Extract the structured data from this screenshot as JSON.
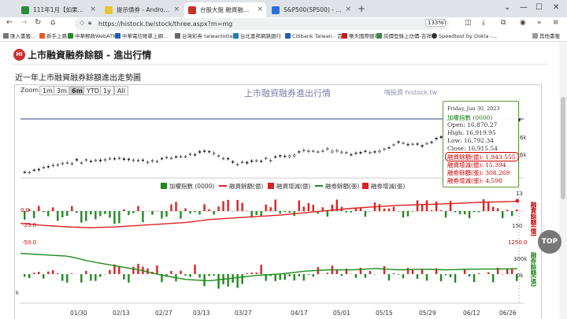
{
  "browser": {
    "tabs": [
      {
        "label": "111年1月【如果認為會影響"
      },
      {
        "label": "提示債券 - Android台灣中文"
      },
      {
        "label": "台股大盤 融資融券進出行情 -"
      },
      {
        "label": "S&P500(SP500) - 動態日K線圖"
      }
    ],
    "url": "https://histock.tw/stock/three.aspx?m=mg",
    "zoom": "133%",
    "bookmarks": [
      "匯入書籤...",
      "新手上路",
      "中華郵政WebATM",
      "中華電信帳單上網...",
      "台灣彩券 taiwanlottery",
      "台北富邦網路銀行",
      "Citibank Taiwan - 首頁",
      "樂天國際銀行",
      "房價登錄上坊價-吉祥",
      "Speedtest by Ookla -..."
    ],
    "other_bookmarks": "其他書籤"
  },
  "page": {
    "logo": "Hi",
    "title": "上市融資融券餘額 - 進出行情",
    "subtitle": "近一年上市融資融券餘額進出走勢圖",
    "top_button": "TOP"
  },
  "chart_toolbar": {
    "zoom_label": "Zoom",
    "buttons": [
      "1m",
      "3m",
      "6m",
      "YTD",
      "1y",
      "All"
    ],
    "selected": "6m"
  },
  "chart_data": {
    "type": "line",
    "title": "上市融資融券進出行情",
    "credit": "嗨投資 histock.tw",
    "legend": [
      {
        "name": "加權指數 (0000)",
        "color": "#1e8a1e",
        "kind": "box"
      },
      {
        "name": "融資餘額(億)",
        "color": "#e02020",
        "kind": "line"
      },
      {
        "name": "融資增減(億)",
        "color": "#e02020",
        "kind": "box"
      },
      {
        "name": "融券餘額(張)",
        "color": "#1e8a1e",
        "kind": "line"
      },
      {
        "name": "融券增減(張)",
        "color": "#e02020",
        "kind": "box"
      }
    ],
    "x_ticks": [
      "01/30",
      "02/13",
      "02/27",
      "03/13",
      "03/27",
      "04/17",
      "05/01",
      "05/15",
      "05/29",
      "06/12",
      "06/26"
    ],
    "margin_axis_labels": [
      "0.0",
      "-25.0",
      "-50.0"
    ],
    "right_labels": [
      "13",
      "150",
      "1250.0",
      "300k",
      "0k",
      "6k",
      "6k",
      "k"
    ],
    "right_titles": [
      "融資餘額(億)",
      "融券餘額(張)"
    ],
    "index_approx": [
      15100,
      15300,
      15450,
      15500,
      15620,
      15480,
      15560,
      15700,
      15800,
      15420,
      15500,
      15650,
      15850,
      15900,
      15750,
      15850,
      16150,
      16000,
      16400,
      16700,
      16900,
      16916
    ],
    "margin_balance_approx": [
      1650,
      1620,
      1600,
      1590,
      1600,
      1620,
      1640,
      1660,
      1700,
      1720,
      1740,
      1760,
      1790,
      1820,
      1850,
      1870,
      1890,
      1900,
      1910,
      1925,
      1935,
      1943.555
    ],
    "short_balance_approx": [
      420000,
      410000,
      400000,
      360000,
      330000,
      300000,
      260000,
      230000,
      220000,
      240000,
      260000,
      270000,
      290000,
      300000,
      300000,
      310000,
      300000,
      305000,
      300000,
      305000,
      306000,
      308269
    ]
  },
  "tooltip": {
    "date": "Friday, Jun 30, 2023",
    "series": "加權指數 (0000)",
    "open": "Open: 16,870.27",
    "high": "High: 16,919.95",
    "low": "Low: 16,792.34",
    "close": "Close: 16,915.54",
    "margin_balance": "融資餘額(億): 1,943.555",
    "margin_change": "融資增減(億): 15.394",
    "short_balance": "融券餘額(張): 308,269",
    "short_change": "融券增減(張): 4,598"
  },
  "colors": {
    "green": "#1e8a1e",
    "red": "#e02020",
    "navy": "#3a3f8f"
  }
}
